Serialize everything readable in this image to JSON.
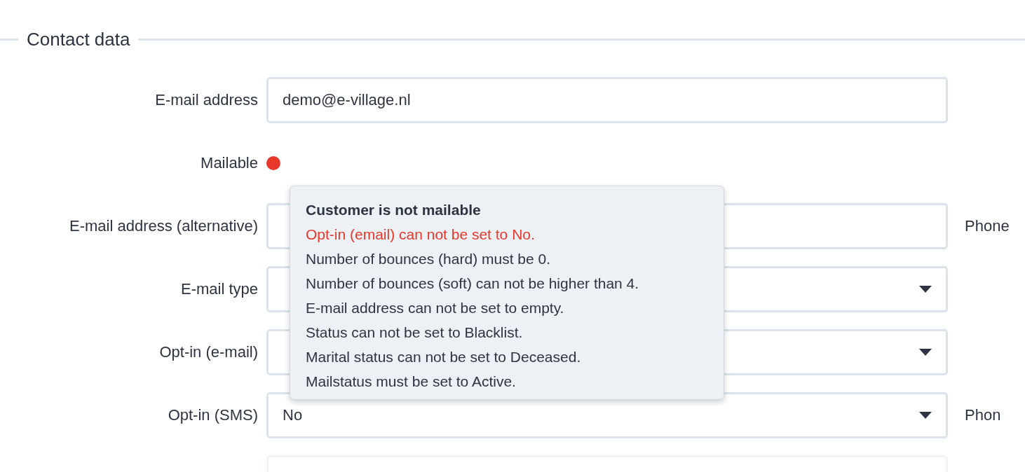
{
  "section": {
    "title": "Contact data"
  },
  "fields": [
    {
      "kind": "text",
      "label": "E-mail address",
      "value": "demo@e-village.nl"
    },
    {
      "kind": "status",
      "label": "Mailable",
      "color": "#e8372b"
    },
    {
      "kind": "text",
      "label": "E-mail address (alternative)",
      "side_label": "Phone"
    },
    {
      "kind": "select",
      "label": "E-mail type"
    },
    {
      "kind": "select",
      "label": "Opt-in (e-mail)"
    },
    {
      "kind": "select",
      "label": "Opt-in (SMS)",
      "value": "No",
      "side_label": "Phon"
    },
    {
      "kind": "faded"
    }
  ],
  "tooltip": {
    "title": "Customer is not mailable",
    "lines": [
      {
        "text": "Opt-in (email) can not be set to No.",
        "failed": true
      },
      {
        "text": "Number of bounces (hard) must be 0.",
        "failed": false
      },
      {
        "text": "Number of bounces (soft) can not be higher than 4.",
        "failed": false
      },
      {
        "text": "E-mail address can not be set to empty.",
        "failed": false
      },
      {
        "text": "Status can not be set to Blacklist.",
        "failed": false
      },
      {
        "text": "Marital status can not be set to Deceased.",
        "failed": false
      },
      {
        "text": "Mailstatus must be set to Active.",
        "failed": false
      }
    ]
  }
}
